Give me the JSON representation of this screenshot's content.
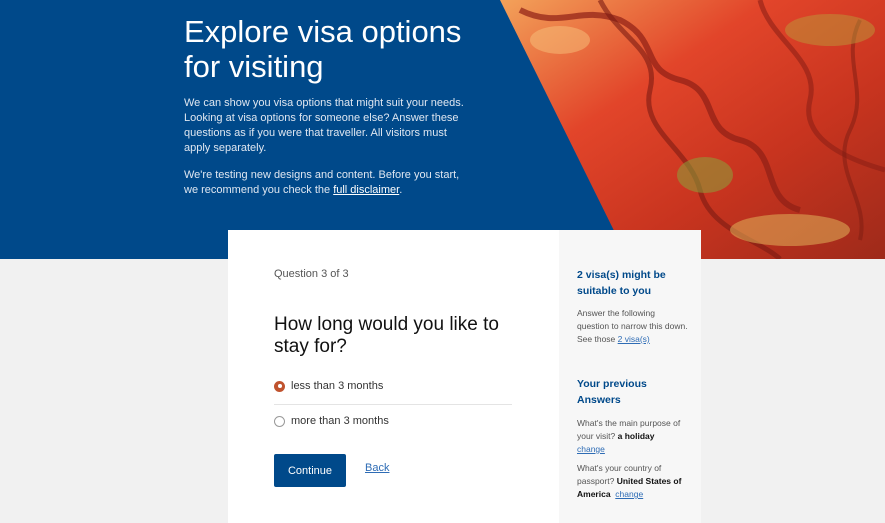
{
  "hero": {
    "title": "Explore visa options for visiting",
    "intro": "We can show you visa options that might suit your needs. Looking at visa options for someone else? Answer these questions as if you were that traveller. All visitors must apply separately.",
    "notice_prefix": "We're testing new designs and content. Before you start, we recommend you check the ",
    "disclaimer_link": "full disclaimer",
    "notice_suffix": "."
  },
  "question": {
    "counter": "Question 3 of 3",
    "title": "How long would you like to stay for?",
    "options": [
      {
        "label": "less than 3 months",
        "selected": true
      },
      {
        "label": "more than 3 months",
        "selected": false
      }
    ],
    "continue_label": "Continue",
    "back_label": "Back"
  },
  "sidebar": {
    "visa_heading": "2 visa(s) might be suitable to you",
    "visa_text": "Answer the following question to narrow this down. See those ",
    "visa_link": "2 visa(s)",
    "answers_heading": "Your previous Answers",
    "answers": [
      {
        "question": "What's the main purpose of your visit?",
        "answer": "a holiday",
        "change": "change"
      },
      {
        "question": "What's your country of passport?",
        "answer": "United States of America",
        "change": "change"
      }
    ]
  },
  "colors": {
    "brand": "#00498a",
    "accent": "#c0532e",
    "link": "#2e6cb5"
  }
}
